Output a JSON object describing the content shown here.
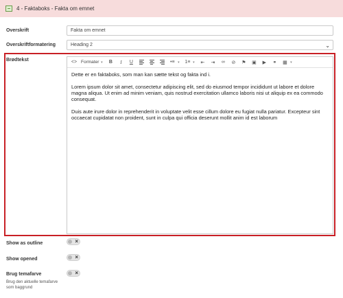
{
  "header": {
    "title": "4 - Faktaboks - Fakta om emnet"
  },
  "fields": {
    "overskrift": {
      "label": "Overskrift",
      "value": "Fakta om emnet"
    },
    "overskriftformatering": {
      "label": "Overskriftformatering",
      "value": "Heading 2"
    },
    "brodtekst": {
      "label": "Brødtekst"
    }
  },
  "toolbar": {
    "formats_label": "Formater"
  },
  "content": {
    "paragraphs": [
      "Dette er en faktaboks, som man kan sætte tekst og fakta ind i.",
      "Lorem ipsum dolor sit amet, consectetur adipiscing elit, sed do eiusmod tempor incididunt ut labore et dolore magna aliqua. Ut enim ad minim veniam, quis nostrud exercitation ullamco laboris nisi ut aliquip ex ea commodo consequat.",
      "Duis aute irure dolor in reprehenderit in voluptate velit esse cillum dolore eu fugiat nulla pariatur. Excepteur sint occaecat cupidatat non proident, sunt in culpa qui officia deserunt mollit anim id est laborum"
    ]
  },
  "toggles": {
    "show_as_outline": {
      "label": "Show as outline",
      "on": false
    },
    "show_opened": {
      "label": "Show opened",
      "on": false
    },
    "brug_temafarve": {
      "label": "Brug temafarve",
      "on": false,
      "hint": "Brug den aktuelle temafarve som baggrund"
    }
  },
  "colors": {
    "header_bg": "#f7dcdc",
    "highlight_border": "#c81f25"
  }
}
